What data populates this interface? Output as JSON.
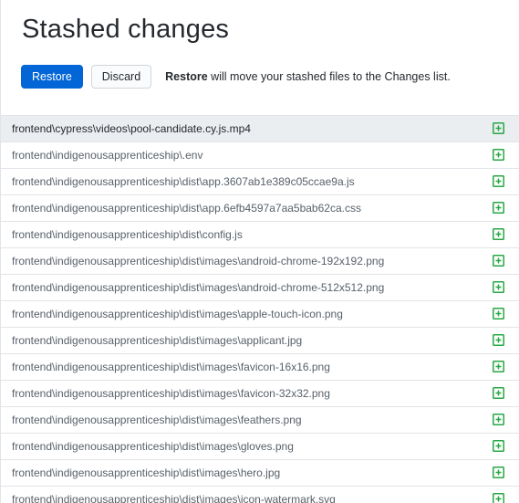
{
  "header": {
    "title": "Stashed changes",
    "restore_label": "Restore",
    "discard_label": "Discard",
    "explanation_strong": "Restore",
    "explanation_rest": " will move your stashed files to the Changes list."
  },
  "colors": {
    "primary": "#0366d6",
    "added_icon": "#28a745",
    "selected_row": "#ebeef1"
  },
  "files": [
    {
      "path": "frontend\\cypress\\videos\\pool-candidate.cy.js.mp4",
      "status": "added",
      "icon": "diff-added-icon",
      "selected": true
    },
    {
      "path": "frontend\\indigenousapprenticeship\\.env",
      "status": "added",
      "icon": "diff-added-icon"
    },
    {
      "path": "frontend\\indigenousapprenticeship\\dist\\app.3607ab1e389c05ccae9a.js",
      "status": "added",
      "icon": "diff-added-icon"
    },
    {
      "path": "frontend\\indigenousapprenticeship\\dist\\app.6efb4597a7aa5bab62ca.css",
      "status": "added",
      "icon": "diff-added-icon"
    },
    {
      "path": "frontend\\indigenousapprenticeship\\dist\\config.js",
      "status": "added",
      "icon": "diff-added-icon"
    },
    {
      "path": "frontend\\indigenousapprenticeship\\dist\\images\\android-chrome-192x192.png",
      "status": "added",
      "icon": "diff-added-icon"
    },
    {
      "path": "frontend\\indigenousapprenticeship\\dist\\images\\android-chrome-512x512.png",
      "status": "added",
      "icon": "diff-added-icon"
    },
    {
      "path": "frontend\\indigenousapprenticeship\\dist\\images\\apple-touch-icon.png",
      "status": "added",
      "icon": "diff-added-icon"
    },
    {
      "path": "frontend\\indigenousapprenticeship\\dist\\images\\applicant.jpg",
      "status": "added",
      "icon": "diff-added-icon"
    },
    {
      "path": "frontend\\indigenousapprenticeship\\dist\\images\\favicon-16x16.png",
      "status": "added",
      "icon": "diff-added-icon"
    },
    {
      "path": "frontend\\indigenousapprenticeship\\dist\\images\\favicon-32x32.png",
      "status": "added",
      "icon": "diff-added-icon"
    },
    {
      "path": "frontend\\indigenousapprenticeship\\dist\\images\\feathers.png",
      "status": "added",
      "icon": "diff-added-icon"
    },
    {
      "path": "frontend\\indigenousapprenticeship\\dist\\images\\gloves.png",
      "status": "added",
      "icon": "diff-added-icon"
    },
    {
      "path": "frontend\\indigenousapprenticeship\\dist\\images\\hero.jpg",
      "status": "added",
      "icon": "diff-added-icon"
    },
    {
      "path": "frontend\\indigenousapprenticeship\\dist\\images\\icon-watermark.svg",
      "status": "added",
      "icon": "diff-added-icon"
    }
  ]
}
